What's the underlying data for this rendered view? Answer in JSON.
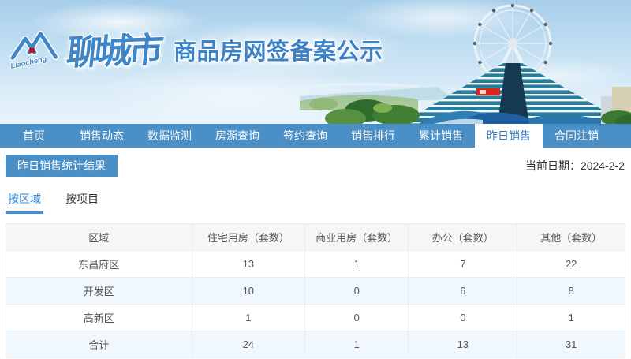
{
  "brand": {
    "logo_script": "Liaocheng",
    "city_name": "聊城市",
    "site_title": "商品房网签备案公示"
  },
  "nav": {
    "items": [
      {
        "label": "首页",
        "active": false
      },
      {
        "label": "销售动态",
        "active": false
      },
      {
        "label": "数据监测",
        "active": false
      },
      {
        "label": "房源查询",
        "active": false
      },
      {
        "label": "签约查询",
        "active": false
      },
      {
        "label": "销售排行",
        "active": false
      },
      {
        "label": "累计销售",
        "active": false
      },
      {
        "label": "昨日销售",
        "active": true
      },
      {
        "label": "合同注销",
        "active": false
      }
    ]
  },
  "content": {
    "section_title": "昨日销售统计结果",
    "current_date": "当前日期：2024-2-2",
    "tabs": [
      {
        "label": "按区域",
        "active": true
      },
      {
        "label": "按项目",
        "active": false
      }
    ],
    "table": {
      "columns": [
        "区域",
        "住宅用房（套数）",
        "商业用房（套数）",
        "办公（套数）",
        "其他（套数）"
      ],
      "rows": [
        [
          "东昌府区",
          "13",
          "1",
          "7",
          "22"
        ],
        [
          "开发区",
          "10",
          "0",
          "6",
          "8"
        ],
        [
          "高新区",
          "1",
          "0",
          "0",
          "1"
        ],
        [
          "合计",
          "24",
          "1",
          "13",
          "31"
        ]
      ]
    }
  },
  "colors": {
    "nav_blue": "#4a8fc6",
    "brand_blue": "#3e86c8",
    "tab_active_blue": "#3288d8",
    "badge_blue": "#4a90c6",
    "table_header_bg": "#f5f6f8",
    "table_alt_row": "#f0f7fd",
    "logo_red": "#c00d0d"
  }
}
